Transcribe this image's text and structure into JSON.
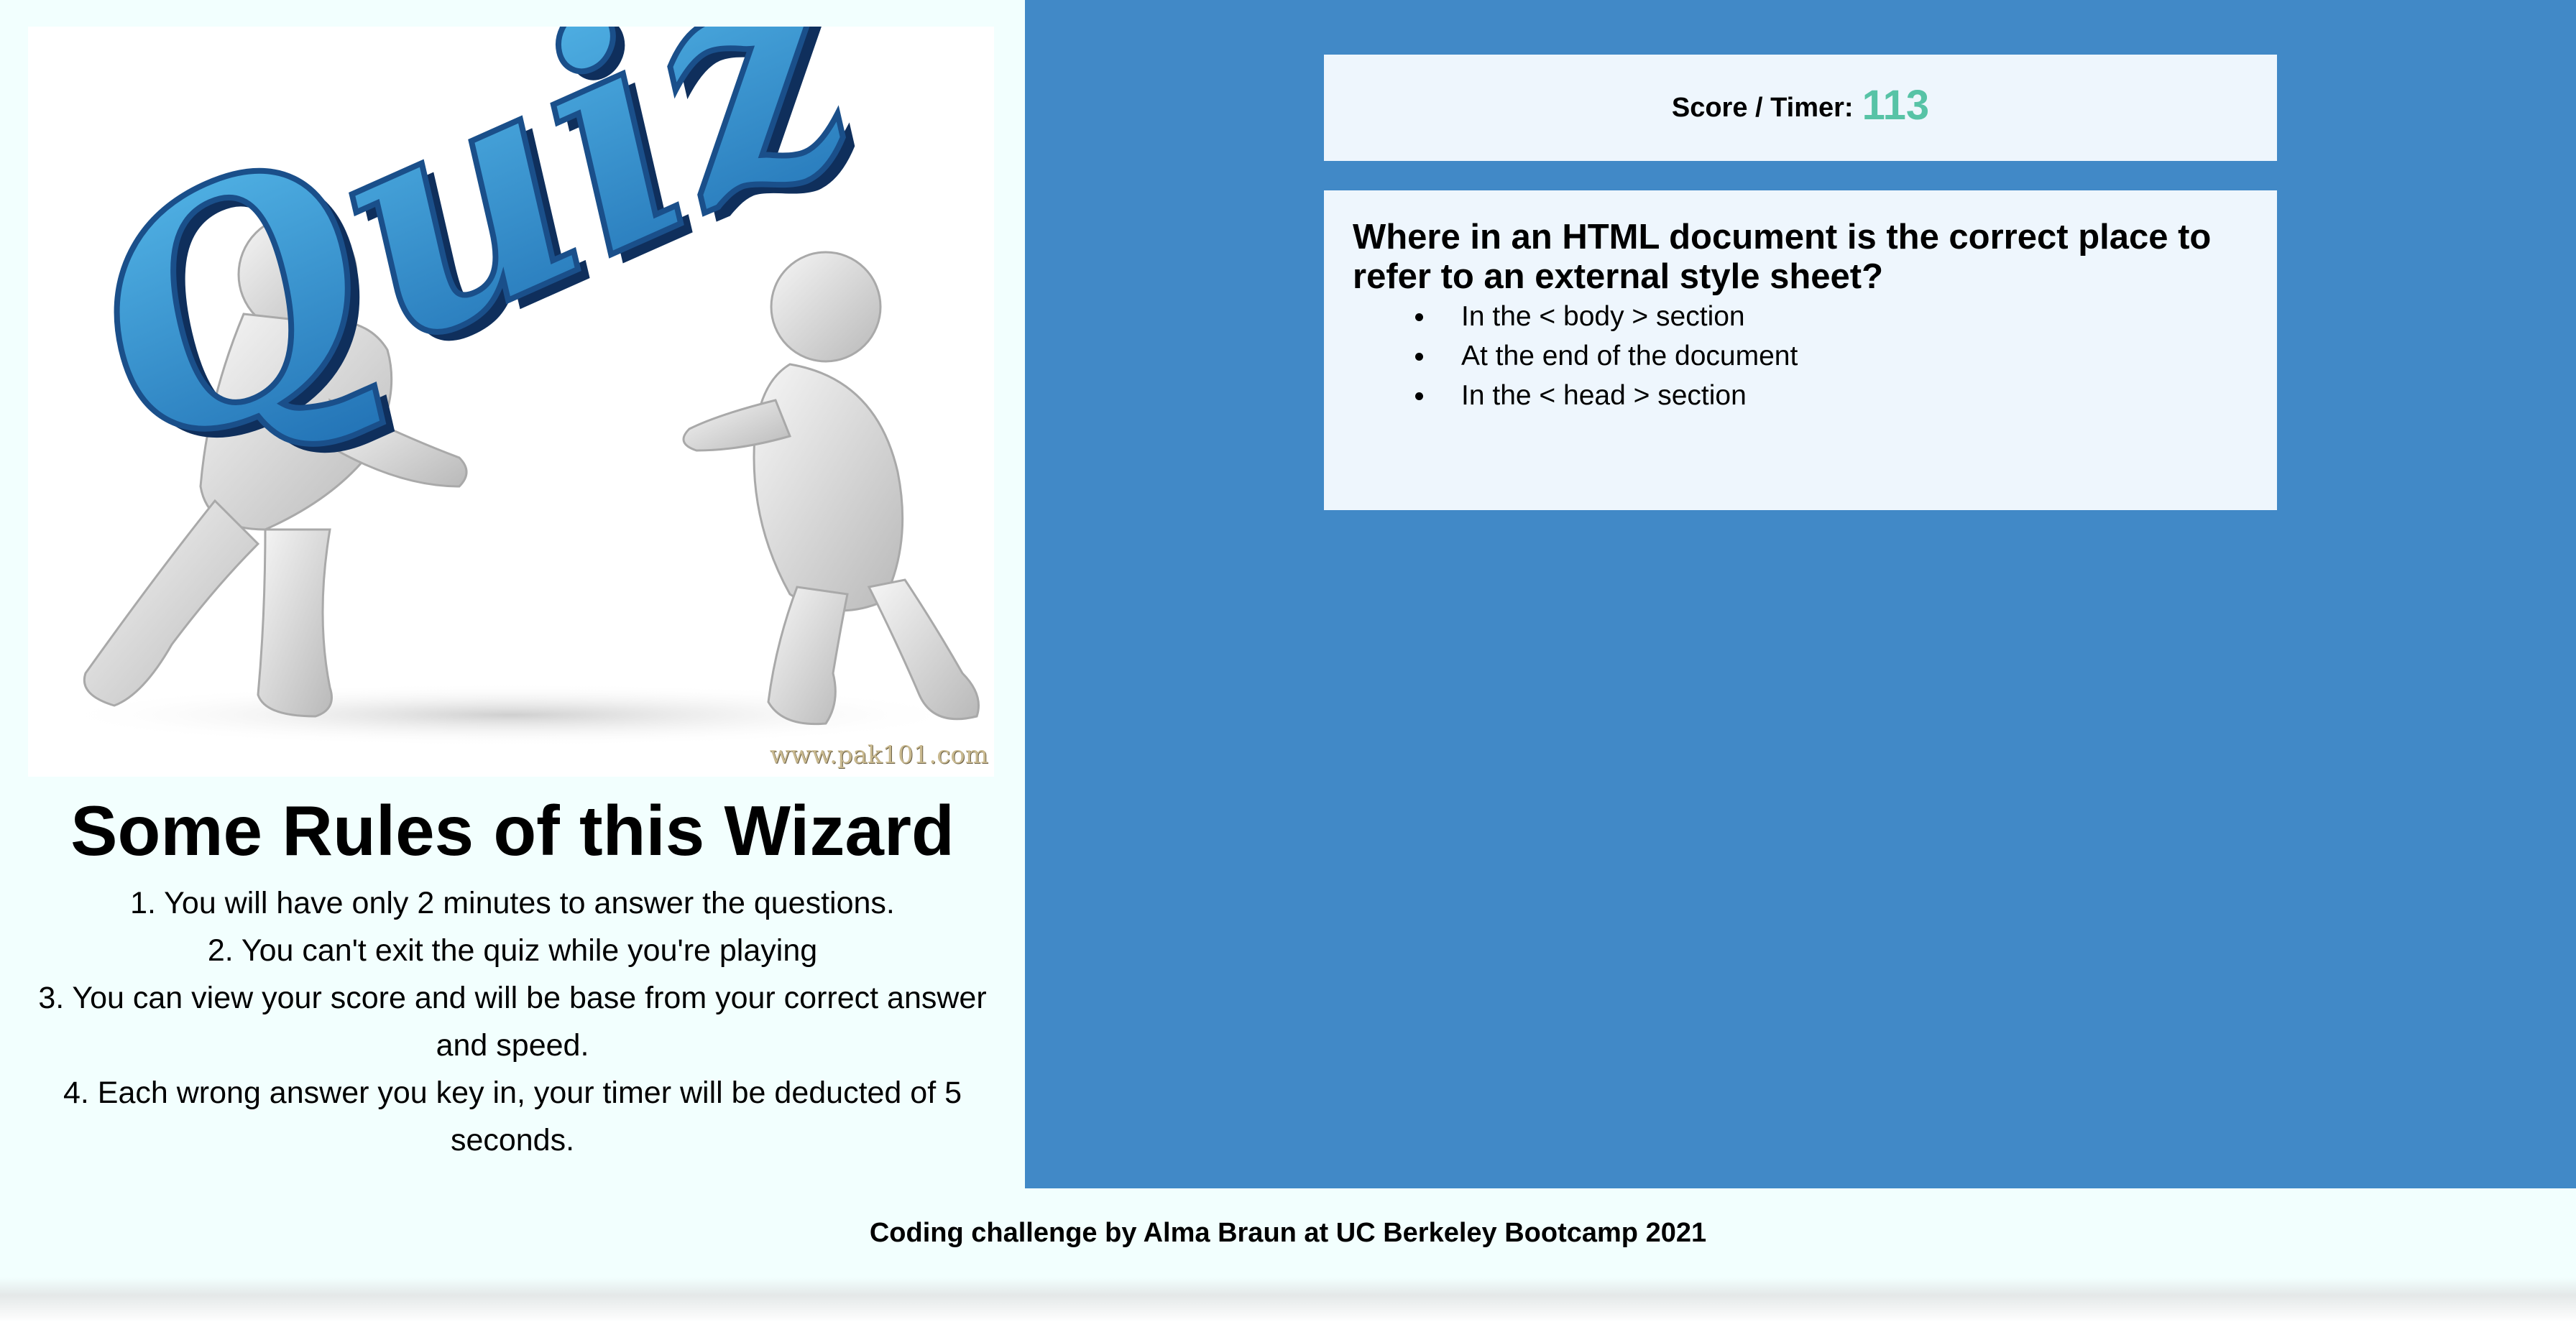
{
  "hero": {
    "image_label": "Quiz",
    "watermark": "www.pak101.com"
  },
  "rules": {
    "title": "Some Rules of this Wizard",
    "items": [
      "1. You will have only 2 minutes to answer the questions.",
      "2. You can't exit the quiz while you're playing",
      "3. You can view your score and will be base from your correct answer and speed.",
      "4. Each wrong answer you key in, your timer will be deducted of 5 seconds."
    ]
  },
  "score": {
    "label": "Score / Timer:",
    "value": "113"
  },
  "question": {
    "text": "Where in an HTML document is the correct place to refer to an external style sheet?",
    "answers": [
      "In the < body > section",
      "At the end of the document",
      "In the < head > section"
    ]
  },
  "footer": {
    "text": "Coding challenge by Alma Braun at UC Berkeley Bootcamp 2021"
  },
  "colors": {
    "page_background": "#f2fffe",
    "right_panel": "#4189c7",
    "card_background": "#eef6fd",
    "score_accent": "#57c3a6"
  }
}
